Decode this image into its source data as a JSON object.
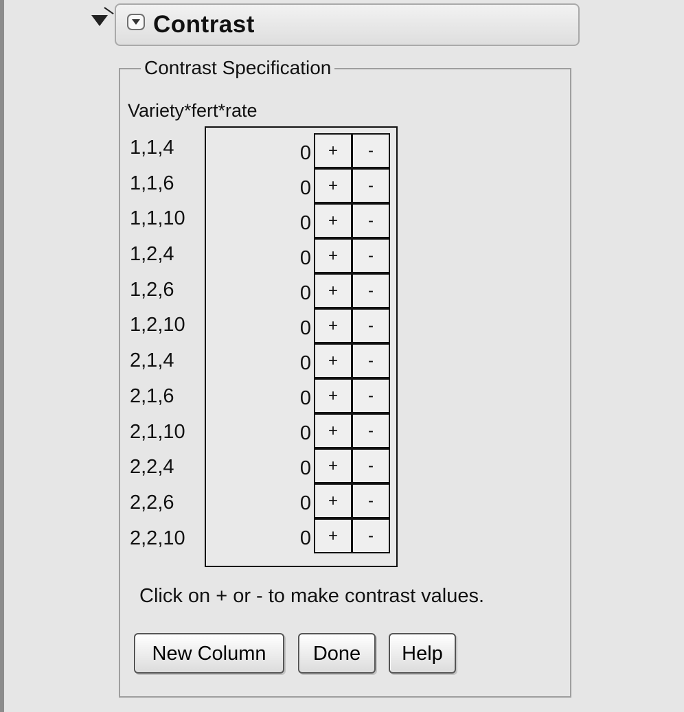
{
  "panel": {
    "title": "Contrast",
    "section_title": "Contrast Specification",
    "factor_label": "Variety*fert*rate",
    "plus_label": "+",
    "minus_label": "-",
    "instruction": "Click on + or - to make contrast values."
  },
  "rows": [
    {
      "label": "1,1,4",
      "value": "0"
    },
    {
      "label": "1,1,6",
      "value": "0"
    },
    {
      "label": "1,1,10",
      "value": "0"
    },
    {
      "label": "1,2,4",
      "value": "0"
    },
    {
      "label": "1,2,6",
      "value": "0"
    },
    {
      "label": "1,2,10",
      "value": "0"
    },
    {
      "label": "2,1,4",
      "value": "0"
    },
    {
      "label": "2,1,6",
      "value": "0"
    },
    {
      "label": "2,1,10",
      "value": "0"
    },
    {
      "label": "2,2,4",
      "value": "0"
    },
    {
      "label": "2,2,6",
      "value": "0"
    },
    {
      "label": "2,2,10",
      "value": "0"
    }
  ],
  "buttons": {
    "new_column": "New Column",
    "done": "Done",
    "help": "Help"
  }
}
